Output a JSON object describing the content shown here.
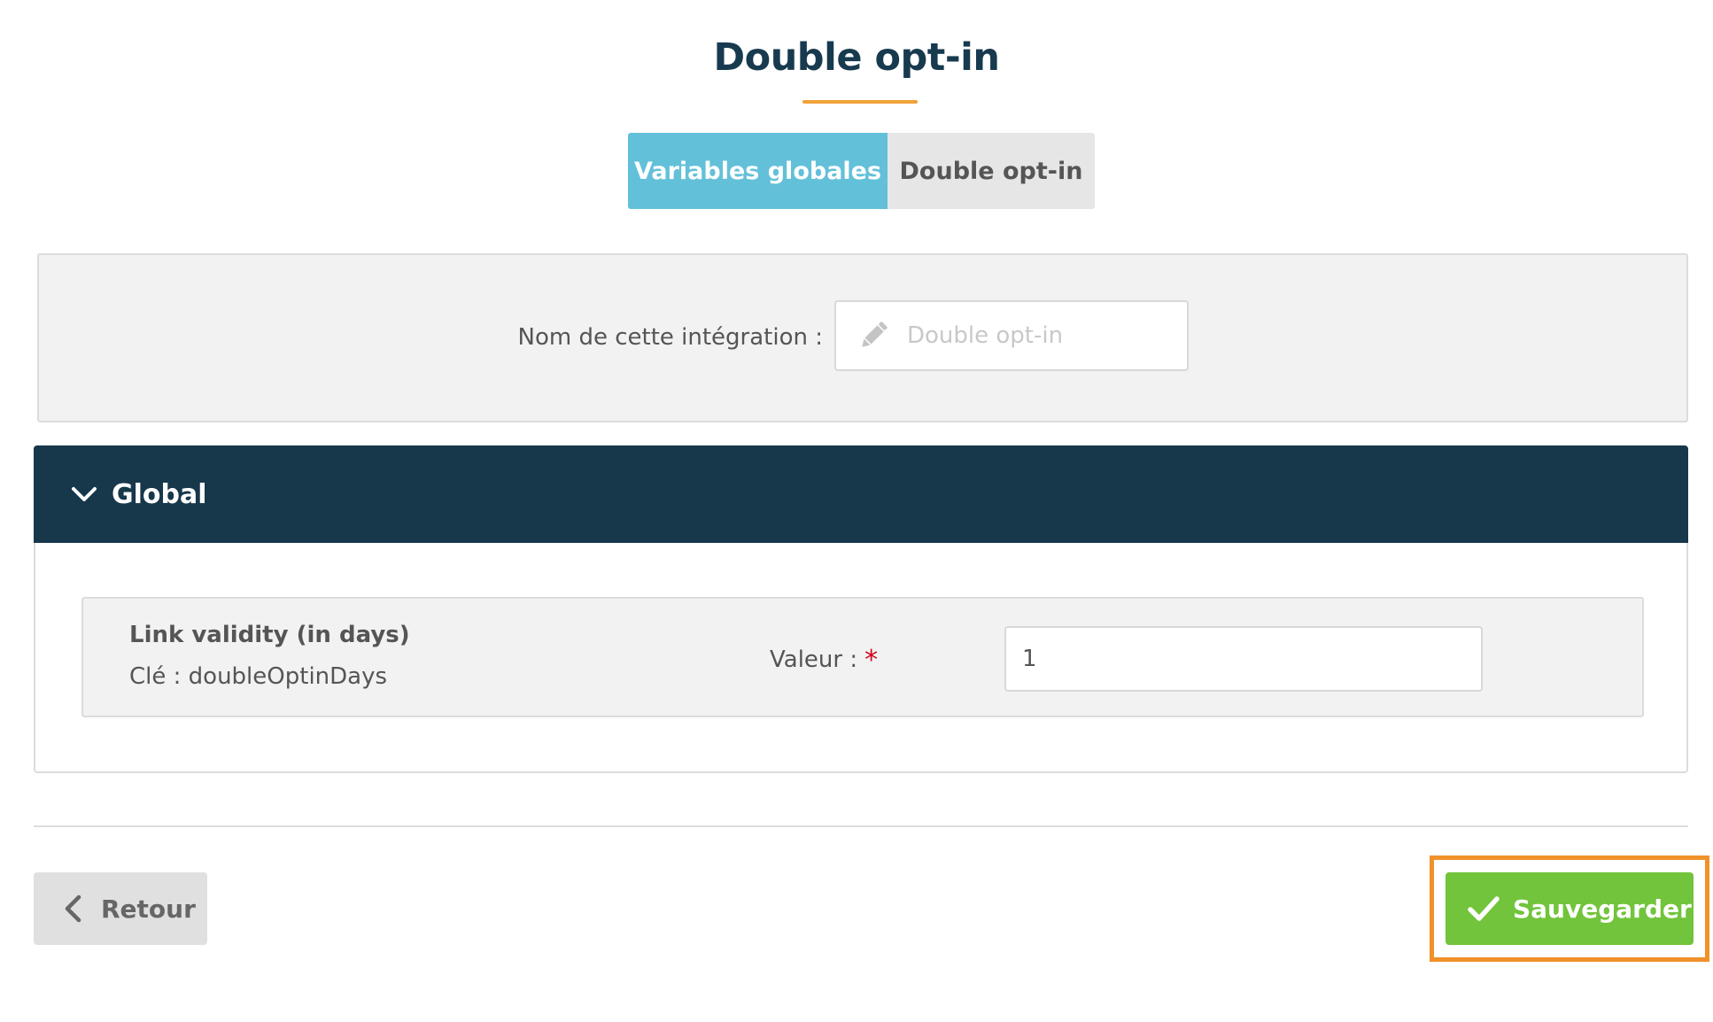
{
  "page": {
    "title": "Double opt-in"
  },
  "tabs": [
    {
      "label": "Variables globales",
      "active": true
    },
    {
      "label": "Double opt-in",
      "active": false
    }
  ],
  "integration": {
    "label": "Nom de cette intégration :",
    "placeholder": "Double opt-in",
    "value": "",
    "icon": "pencil-icon"
  },
  "section": {
    "title": "Global",
    "icon": "chevron-down-icon",
    "expanded": true
  },
  "variable": {
    "name": "Link validity (in days)",
    "key_text": "Clé : doubleOptinDays",
    "value_label": "Valeur :",
    "required_mark": "*",
    "value": "1"
  },
  "footer": {
    "back_label": "Retour",
    "back_icon": "chevron-left-icon",
    "save_label": "Sauvegarder",
    "save_icon": "check-icon"
  },
  "colors": {
    "title": "#173a4f",
    "accent": "#f1a13b",
    "tab_active": "#63c0d9",
    "section_header": "#17374b",
    "save": "#71c43b",
    "required": "#d0021b",
    "highlight": "#f0912a"
  }
}
